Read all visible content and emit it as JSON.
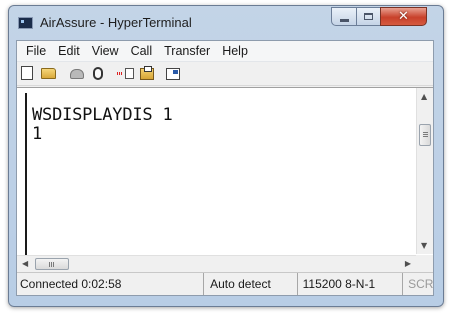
{
  "window": {
    "title": "AirAssure - HyperTerminal"
  },
  "icons": {
    "app": "hyperterminal-icon",
    "minimize": "minimize-icon",
    "maximize": "maximize-icon",
    "close": "close-icon",
    "close_glyph": "✕",
    "scroll_up": "▲",
    "scroll_down": "▼",
    "scroll_left": "◀",
    "scroll_right": "▶"
  },
  "menu": [
    "File",
    "Edit",
    "View",
    "Call",
    "Transfer",
    "Help"
  ],
  "toolbar": [
    "new-icon",
    "open-icon",
    "connect-icon",
    "disconnect-icon",
    "send-icon",
    "receive-icon",
    "properties-icon"
  ],
  "terminal": {
    "lines": [
      "WSDISPLAYDIS 1",
      "1"
    ]
  },
  "status": {
    "connected": "Connected 0:02:58",
    "detect": "Auto detect",
    "port": "115200 8-N-1",
    "scroll": "SCROLL"
  },
  "colors": {
    "frame": "#b8cde5",
    "close": "#c8412b",
    "terminal_bg": "#ffffff"
  }
}
